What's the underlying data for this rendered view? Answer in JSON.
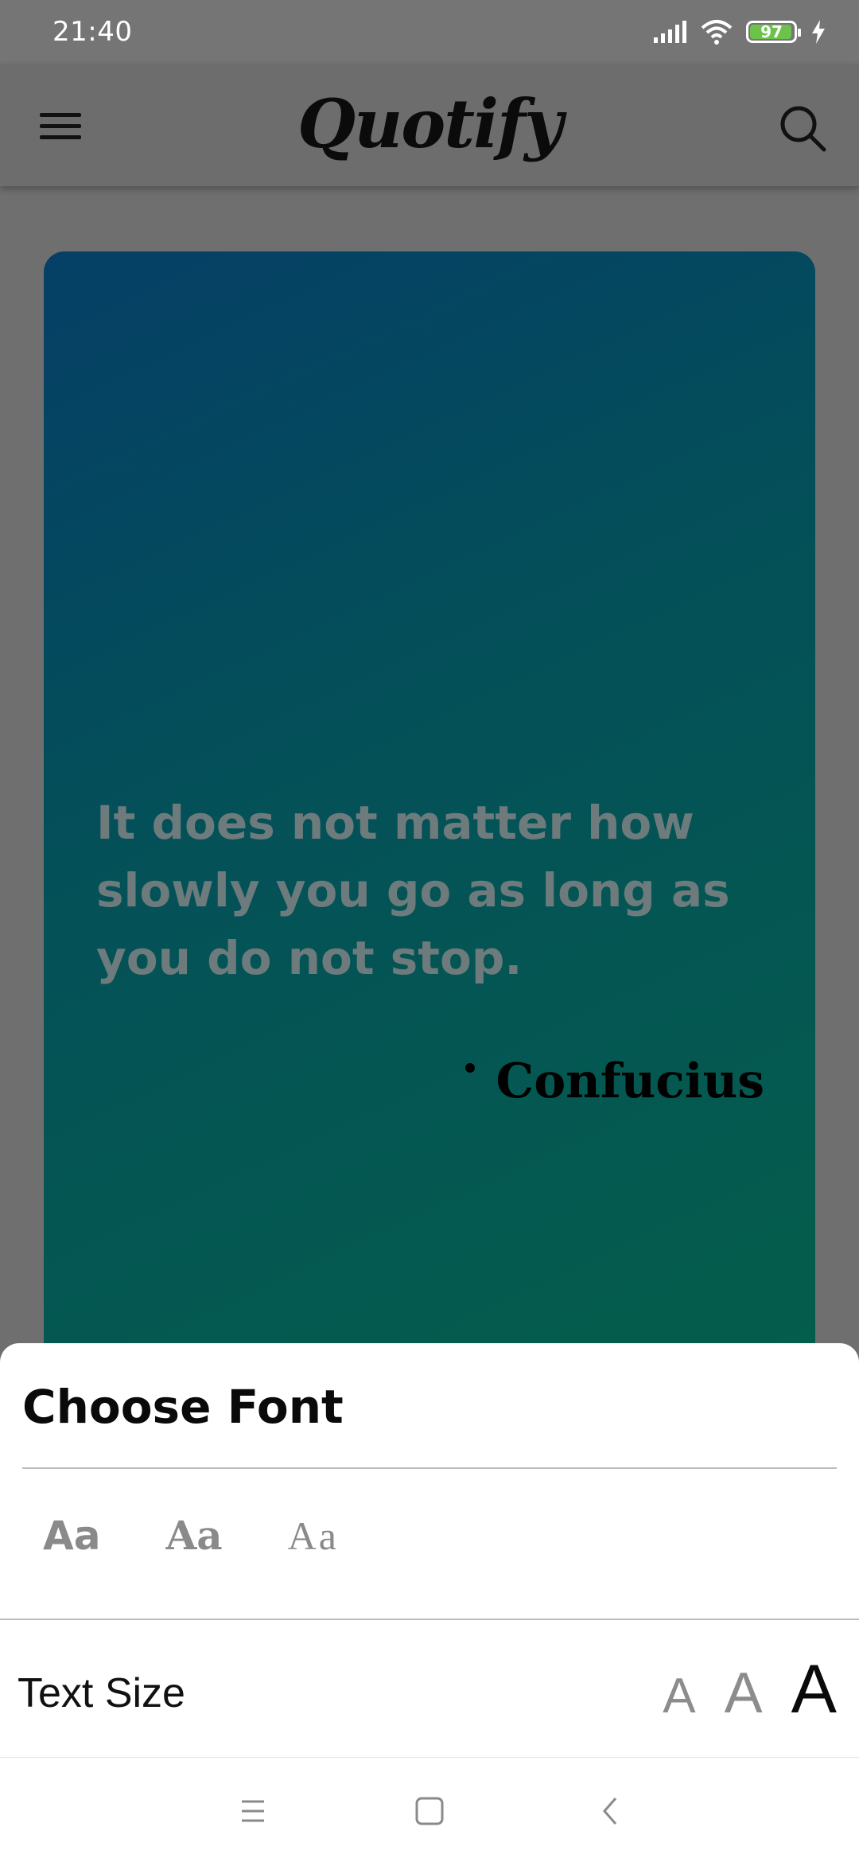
{
  "status_bar": {
    "time": "21:40",
    "battery_level": "97",
    "battery_color": "#6cc24a",
    "icons": [
      "signal-icon",
      "wifi-icon",
      "battery-icon",
      "charging-icon"
    ]
  },
  "app_bar": {
    "title": "Quotify",
    "menu_icon": "hamburger-menu-icon",
    "search_icon": "search-icon"
  },
  "quote_card": {
    "text": "It does not matter how slowly you go as long as you do not stop.",
    "author": "Confucius",
    "gradient_colors": [
      "#053f66",
      "#045158",
      "#045e4b"
    ]
  },
  "font_sheet": {
    "title": "Choose Font",
    "font_options": [
      {
        "label": "Aa"
      },
      {
        "label": "Aa"
      },
      {
        "label": "Aa"
      }
    ],
    "text_size_label": "Text Size",
    "size_options": [
      {
        "label": "A",
        "size": "small"
      },
      {
        "label": "A",
        "size": "medium"
      },
      {
        "label": "A",
        "size": "large",
        "selected": true
      }
    ]
  },
  "nav_bar": {
    "icons": [
      "recent-apps-icon",
      "home-icon",
      "back-icon"
    ]
  }
}
